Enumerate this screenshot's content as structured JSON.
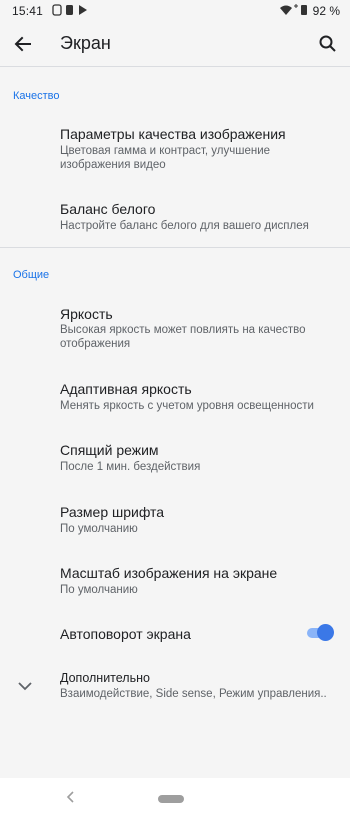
{
  "status_bar": {
    "time": "15:41",
    "battery": "92 %"
  },
  "app_bar": {
    "title": "Экран",
    "back_icon": "arrow-left-icon",
    "search_icon": "search-icon"
  },
  "sections": {
    "quality": {
      "header": "Качество",
      "items": [
        {
          "title": "Параметры качества изображения",
          "subtitle": "Цветовая гамма и контраст, улучшение изображения видео"
        },
        {
          "title": "Баланс белого",
          "subtitle": "Настройте баланс белого для вашего дисплея"
        }
      ]
    },
    "general": {
      "header": "Общие",
      "items": [
        {
          "title": "Яркость",
          "subtitle": "Высокая яркость может повлиять на качество отображения"
        },
        {
          "title": "Адаптивная яркость",
          "subtitle": "Менять яркость с учетом уровня освещенности"
        },
        {
          "title": "Спящий режим",
          "subtitle": "После 1 мин. бездействия"
        },
        {
          "title": "Размер шрифта",
          "subtitle": "По умолчанию"
        },
        {
          "title": "Масштаб изображения на экране",
          "subtitle": "По умолчанию"
        },
        {
          "title": "Автоповорот экрана",
          "toggle_on": true
        },
        {
          "title": "Дополнительно",
          "subtitle": "Взаимодействие, Side sense, Режим управления.."
        }
      ]
    }
  },
  "colors": {
    "accent": "#1a73e8",
    "toggle_thumb": "#3b78e7",
    "toggle_track": "#8ab4f8",
    "background": "#f5f5f5"
  }
}
